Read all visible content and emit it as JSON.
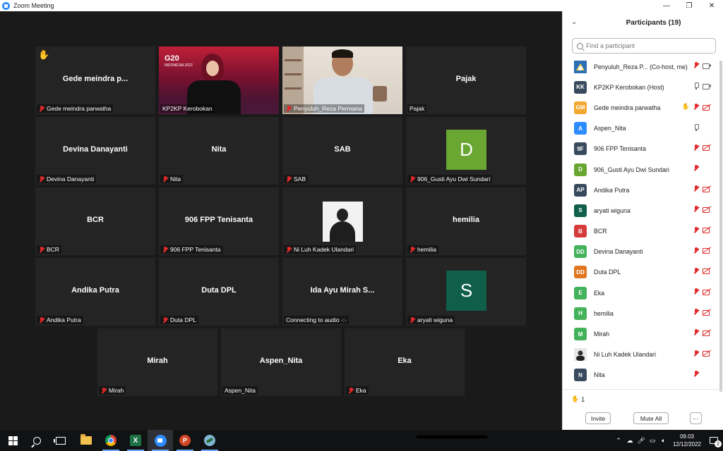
{
  "window": {
    "title": "Zoom Meeting",
    "controls": [
      "—",
      "❐",
      "✕"
    ]
  },
  "gallery": {
    "tiles": [
      {
        "name": "Gede meindra p...",
        "label": "Gede meindra parwatha",
        "muted": true,
        "hand": true
      },
      {
        "name": "",
        "label": "KP2KP Kerobokan",
        "muted": false,
        "video": "g20",
        "active": true,
        "logo_text": "G20",
        "logo_sub": "INDONESIA 2022"
      },
      {
        "name": "",
        "label": "Penyuluh_Reza Permana",
        "muted": true,
        "video": "room"
      },
      {
        "name": "Pajak",
        "label": "Pajak",
        "muted": false
      },
      {
        "name": "Devina Danayanti",
        "label": "Devina Danayanti",
        "muted": true
      },
      {
        "name": "Nita",
        "label": "Nita",
        "muted": true
      },
      {
        "name": "SAB",
        "label": "SAB",
        "muted": true
      },
      {
        "name": "",
        "label": "906_Gusti Ayu Dwi Sundari",
        "muted": true,
        "avatar_letter": "D",
        "avatar_color": "#6aa632"
      },
      {
        "name": "BCR",
        "label": "BCR",
        "muted": true
      },
      {
        "name": "906 FPP Tenisanta",
        "label": "906 FPP Tenisanta",
        "muted": true
      },
      {
        "name": "",
        "label": "Ni Luh Kadek Ulandari",
        "muted": true,
        "photo": true
      },
      {
        "name": "hemilia",
        "label": "hemilia",
        "muted": true
      },
      {
        "name": "Andika Putra",
        "label": "Andika Putra",
        "muted": true
      },
      {
        "name": "Duta DPL",
        "label": "Duta DPL",
        "muted": true
      },
      {
        "name": "Ida Ayu Mirah S...",
        "label": "Connecting to audio ·:·",
        "muted": false
      },
      {
        "name": "",
        "label": "aryati wiguna",
        "muted": true,
        "avatar_letter": "S",
        "avatar_color": "#0f5f4a"
      },
      {
        "name": "Mirah",
        "label": "Mirah",
        "muted": true
      },
      {
        "name": "Aspen_Nita",
        "label": "Aspen_Nita",
        "muted": false
      },
      {
        "name": "Eka",
        "label": "Eka",
        "muted": true
      }
    ]
  },
  "participants": {
    "title": "Participants (19)",
    "search_placeholder": "Find a participant",
    "list": [
      {
        "initials": "",
        "color": "#2d6fb5",
        "name": "Penyuluh_Reza P...  (Co-host, me)",
        "mic": "off",
        "video": "on",
        "hand": false
      },
      {
        "initials": "KK",
        "color": "#3a4a5e",
        "name": "KP2KP Kerobokan (Host)",
        "mic": "on",
        "video": "on",
        "hand": false
      },
      {
        "initials": "GM",
        "color": "#f0a830",
        "name": "Gede meindra parwatha",
        "mic": "off",
        "video": "off",
        "hand": true
      },
      {
        "initials": "A",
        "color": "#2d8cff",
        "name": "Aspen_Nita",
        "mic": "on",
        "video": "none",
        "hand": false
      },
      {
        "initials": "9F",
        "color": "#3a4a5e",
        "name": "906 FPP Tenisanta",
        "mic": "off",
        "video": "off",
        "hand": false
      },
      {
        "initials": "D",
        "color": "#6aa632",
        "name": "906_Gusti Ayu Dwi Sundari",
        "mic": "off",
        "video": "none",
        "hand": false
      },
      {
        "initials": "AP",
        "color": "#3a4a5e",
        "name": "Andika Putra",
        "mic": "off",
        "video": "off",
        "hand": false
      },
      {
        "initials": "S",
        "color": "#0f5f4a",
        "name": "aryati wiguna",
        "mic": "off",
        "video": "off",
        "hand": false
      },
      {
        "initials": "B",
        "color": "#d63c3c",
        "name": "BCR",
        "mic": "off",
        "video": "off",
        "hand": false
      },
      {
        "initials": "DD",
        "color": "#43b25b",
        "name": "Devina Danayanti",
        "mic": "off",
        "video": "off",
        "hand": false
      },
      {
        "initials": "DD",
        "color": "#e0761e",
        "name": "Duta DPL",
        "mic": "off",
        "video": "off",
        "hand": false
      },
      {
        "initials": "E",
        "color": "#43b25b",
        "name": "Eka",
        "mic": "off",
        "video": "off",
        "hand": false
      },
      {
        "initials": "H",
        "color": "#43b25b",
        "name": "hemilia",
        "mic": "off",
        "video": "off",
        "hand": false
      },
      {
        "initials": "M",
        "color": "#43b25b",
        "name": "Mirah",
        "mic": "off",
        "video": "off",
        "hand": false
      },
      {
        "initials": "",
        "color": "#d9d9d9",
        "name": "Ni Luh Kadek Ulandari",
        "mic": "off",
        "video": "off",
        "hand": false
      },
      {
        "initials": "N",
        "color": "#3a4a5e",
        "name": "Nita",
        "mic": "off",
        "video": "none",
        "hand": false
      }
    ],
    "raised_count": "1",
    "invite_label": "Invite",
    "mute_all_label": "Mute All",
    "more_label": "···"
  },
  "taskbar": {
    "time": "09.03",
    "date": "12/12/2022",
    "notifications": "2",
    "apps": [
      "start",
      "search",
      "task-view",
      "file-explorer",
      "chrome",
      "excel",
      "zoom",
      "powerpoint",
      "other-app"
    ]
  }
}
